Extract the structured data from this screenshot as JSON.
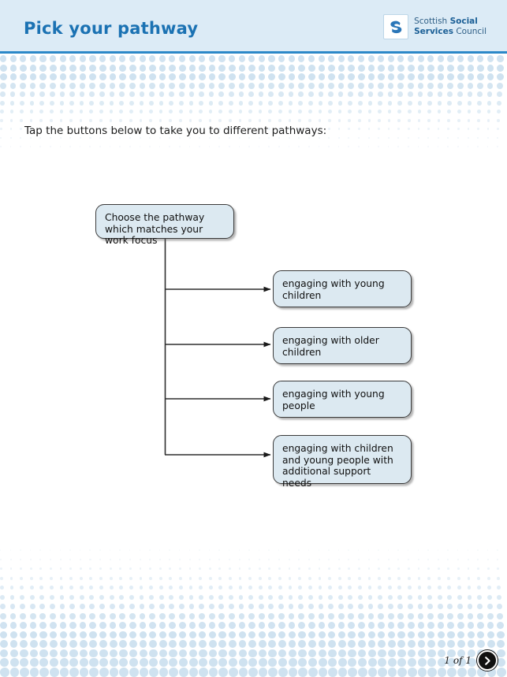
{
  "header": {
    "title": "Pick your pathway",
    "logo": {
      "line1_regular": "Scottish ",
      "line1_bold": "Social",
      "line2_bold": "Services",
      "line2_regular": " Council",
      "mark": "ssc-s-swirl-logo"
    },
    "accent_color": "#2b88c8",
    "background_color": "#dcebf6",
    "title_color": "#1b72b3"
  },
  "main": {
    "instruction": "Tap the buttons below to take you to different pathways:",
    "root_node": "Choose the pathway which matches your work focus",
    "options": [
      "engaging with young children",
      "engaging with older children",
      "engaging with young people",
      "engaging with children and young people with additional support needs"
    ],
    "node_fill_color": "#dce9f1",
    "node_border_color": "#3a3a3a"
  },
  "footer": {
    "page_count": "1 of 1",
    "next_icon": "chevron-right-icon"
  },
  "decor": {
    "dot_color": "#cfe2f0"
  }
}
